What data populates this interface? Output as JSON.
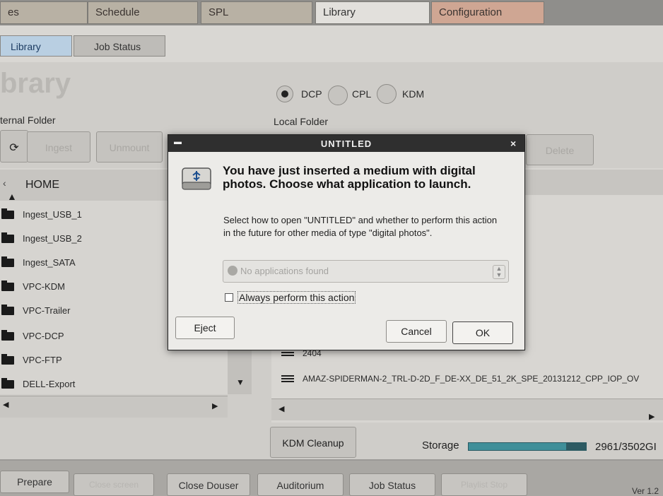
{
  "top_tabs": {
    "first": "es",
    "schedule": "Schedule",
    "spl": "SPL",
    "library": "Library",
    "configuration": "Configuration"
  },
  "sub_tabs": {
    "library": "Library",
    "job_status": "Job Status"
  },
  "page_title": "brary",
  "content_types": {
    "dcp": "DCP",
    "cpl": "CPL",
    "kdm": "KDM",
    "selected": "DCP"
  },
  "external_folder": {
    "label": "ternal Folder",
    "ingest_button": "Ingest",
    "unmount_button": "Unmount",
    "home_label": "HOME",
    "items": [
      "Ingest_USB_1",
      "Ingest_USB_2",
      "Ingest_SATA",
      "VPC-KDM",
      "VPC-Trailer",
      "VPC-DCP",
      "VPC-FTP",
      "DELL-Export"
    ]
  },
  "local_folder": {
    "label": "Local Folder",
    "delete_button": "Delete",
    "items": [
      "2404",
      "AMAZ-SPIDERMAN-2_TRL-D-2D_F_DE-XX_DE_51_2K_SPE_20131212_CPP_IOP_OV"
    ]
  },
  "kdm_cleanup_button": "KDM Cleanup",
  "storage": {
    "label": "Storage",
    "value": "2961/3502GI",
    "used_fraction": 0.85
  },
  "bottom_bar": {
    "prepare": "Prepare",
    "close_screen": "Close screen",
    "close_douser": "Close Douser",
    "auditorium": "Auditorium",
    "job_status": "Job Status",
    "playlist_stop": "Playlist Stop",
    "version": "Ver 1.2"
  },
  "dialog": {
    "title": "UNTITLED",
    "close": "×",
    "heading": "You have just inserted a medium with digital photos. Choose what application to launch.",
    "description": "Select how to open \"UNTITLED\" and whether to perform this action in the future for other media of type \"digital photos\".",
    "combo_placeholder": "No applications found",
    "checkbox_label": "Always perform this action",
    "checkbox_checked": false,
    "eject": "Eject",
    "cancel": "Cancel",
    "ok": "OK"
  }
}
